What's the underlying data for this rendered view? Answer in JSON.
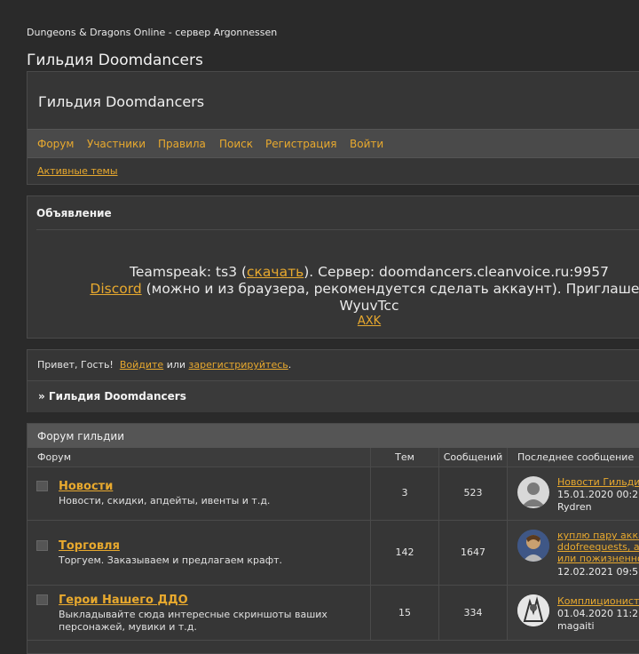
{
  "site": {
    "top_title": "Dungeons & Dragons Online - сервер Argonnessen",
    "title": "Гильдия Doomdancers"
  },
  "header": {
    "title": "Гильдия Doomdancers",
    "nav": [
      "Форум",
      "Участники",
      "Правила",
      "Поиск",
      "Регистрация",
      "Войти"
    ],
    "subnav": "Активные темы"
  },
  "announcement": {
    "title": "Объявление",
    "teamspeak_prefix": "Teamspeak: ts3 (",
    "teamspeak_link": "скачать",
    "teamspeak_suffix": "). Сервер: doomdancers.cleanvoice.ru:9957",
    "discord_link": "Discord",
    "discord_text": " (можно и из браузера, рекомендуется сделать аккаунт). Приглашен",
    "discord_code": "WyuvTcc",
    "axk_link": "AXK"
  },
  "guest": {
    "greeting": "Привет, Гость!",
    "login_link": "Войдите",
    "or": "или",
    "register_link": "зарегистрируйтесь",
    "period": ".",
    "breadcrumb": "» Гильдия Doomdancers"
  },
  "forum": {
    "title": "Форум гильдии",
    "columns": [
      "Форум",
      "Тем",
      "Сообщений",
      "Последнее сообщение"
    ],
    "rows": [
      {
        "name": "Новости",
        "desc": "Новости, скидки, апдейты, ивенты и т.д.",
        "topics": "3",
        "posts": "523",
        "last_title": "Новости Гильдии",
        "last_date": "15.01.2020 00:2",
        "last_user": "Rydren",
        "avatar": "default-avatar-icon"
      },
      {
        "name": "Торговля",
        "desc": "Торгуем. Заказываем и предлагаем крафт.",
        "topics": "142",
        "posts": "1647",
        "last_title_lines": [
          "куплю пару акка",
          "ddofreequests, a",
          "или пожизненно"
        ],
        "last_date": "12.02.2021 09:5",
        "last_user": "",
        "avatar": "character-avatar-icon"
      },
      {
        "name": "Герои Нашего ДДО",
        "desc": "Выкладывайте сюда интересные скриншоты ваших персонажей, мувики и т.д.",
        "topics": "15",
        "posts": "334",
        "last_title": "Комплиционист",
        "last_date": "01.04.2020 11:2",
        "last_user": "magaiti",
        "avatar": "sketch-avatar-icon"
      }
    ]
  },
  "colors": {
    "link": "#e8a92e",
    "page_bg": "#2a2a2a",
    "panel_bg": "#363636"
  }
}
